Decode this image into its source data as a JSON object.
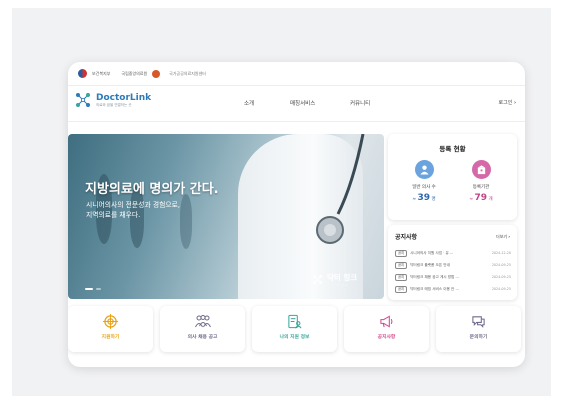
{
  "gov_bar": {
    "org1": "보건복지부",
    "org2": "국립중앙의료원",
    "org3": "국가공공의료지원센터"
  },
  "brand": {
    "name": "DoctorLink",
    "tagline": "의료와 꿈을 연결하는 곳"
  },
  "nav": {
    "items": [
      "소개",
      "매칭서비스",
      "커뮤니티"
    ],
    "member_link": "로그인"
  },
  "hero": {
    "title": "지방의료에 명의가 간다.",
    "subtitle_lines": [
      "시니어의사의 전문성과 경험으로,",
      "지역의료를 채우다."
    ],
    "logo_text": "닥터 링크",
    "logo_sub": "DOCTOR LINK"
  },
  "registration": {
    "title": "등록 현황",
    "doctor": {
      "label": "일반 의사 수",
      "value": "39",
      "unit": "명"
    },
    "institution": {
      "label": "등록기관",
      "value": "79",
      "unit": "개"
    }
  },
  "notices": {
    "title": "공지사항",
    "more": "더보기",
    "items": [
      {
        "tag": "공지",
        "text": "시니어의사 지원 사업 · 유 ...",
        "date": "2024-12-20"
      },
      {
        "tag": "공지",
        "text": "닥터링크 플랫폼 오픈 안내",
        "date": "2024-09-25"
      },
      {
        "tag": "공지",
        "text": "닥터링크 채용 공고 게시 방법 ...",
        "date": "2024-09-25"
      },
      {
        "tag": "공지",
        "text": "닥터링크 매칭 서비스 이용 안 ...",
        "date": "2024-09-25"
      }
    ]
  },
  "quick_links": [
    {
      "label": "지원하기",
      "icon": "target-icon",
      "color": "#e8a317"
    },
    {
      "label": "의사 채용 공고",
      "icon": "doctors-group-icon",
      "color": "#6f6a8a"
    },
    {
      "label": "나의 지원 정보",
      "icon": "document-user-icon",
      "color": "#3aa59b"
    },
    {
      "label": "공지사항",
      "icon": "megaphone-icon",
      "color": "#d14b8f"
    },
    {
      "label": "문의하기",
      "icon": "chat-bubble-icon",
      "color": "#6f6a8a"
    }
  ],
  "colors": {
    "brand_blue": "#2d7bb8",
    "doctor_accent": "#2e67b1",
    "institution_accent": "#c2448a"
  }
}
